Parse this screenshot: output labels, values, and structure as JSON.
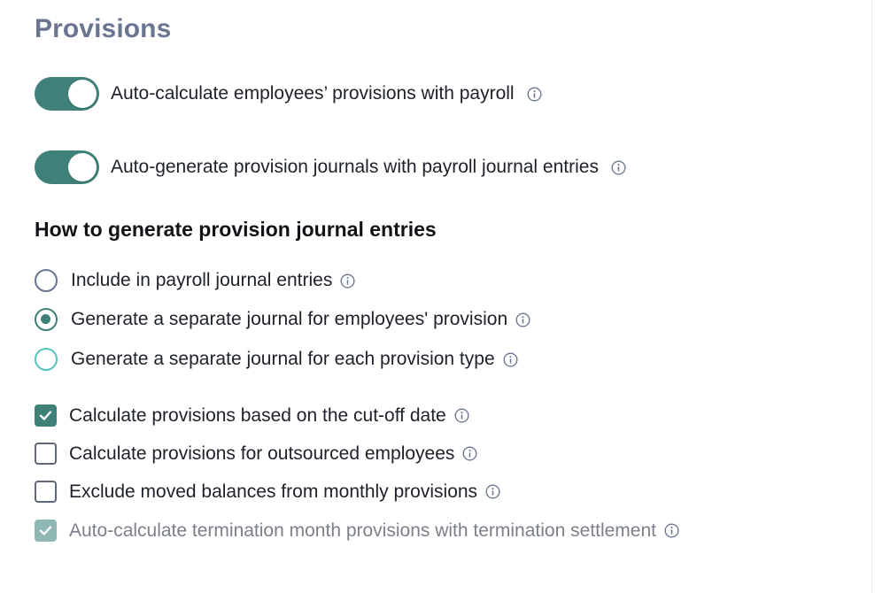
{
  "section": {
    "title": "Provisions"
  },
  "toggles": [
    {
      "label": "Auto-calculate employees’ provisions with payroll",
      "on": true
    },
    {
      "label": "Auto-generate provision journals with payroll journal entries",
      "on": true
    }
  ],
  "journal": {
    "heading": "How to generate provision journal entries",
    "options": [
      {
        "label": "Include in payroll journal entries",
        "selected": false
      },
      {
        "label": "Generate a separate journal for employees' provision",
        "selected": true
      },
      {
        "label": "Generate a separate journal for each provision type",
        "selected": false
      }
    ]
  },
  "checkboxes": [
    {
      "label": "Calculate provisions based on the cut-off date",
      "checked": true,
      "disabled": false
    },
    {
      "label": "Calculate provisions for outsourced employees",
      "checked": false,
      "disabled": false
    },
    {
      "label": "Exclude moved balances from monthly provisions",
      "checked": false,
      "disabled": false
    },
    {
      "label": "Auto-calculate termination month provisions with termination settlement",
      "checked": true,
      "disabled": true
    }
  ],
  "colors": {
    "accent": "#3f8079",
    "title": "#6a7591",
    "radio_hover": "#56c3bd",
    "disabled_check": "#8fb7b3"
  },
  "icons": {
    "info": "info-circle-icon",
    "check": "checkmark-icon"
  }
}
